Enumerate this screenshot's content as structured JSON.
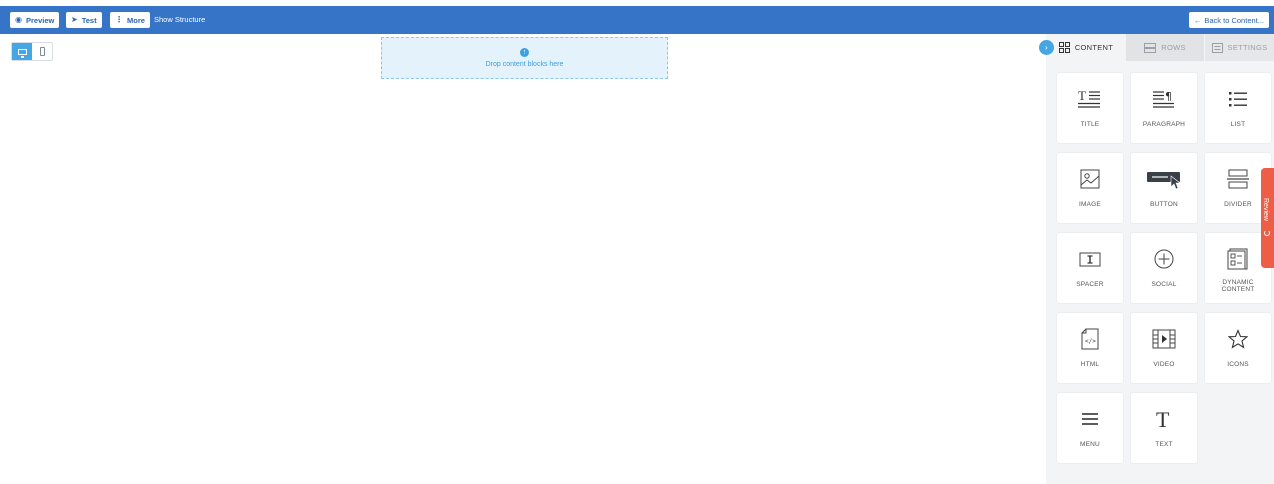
{
  "toolbar": {
    "preview_label": "Preview",
    "test_label": "Test",
    "more_label": "More",
    "show_structure_label": "Show Structure",
    "back_label": "Back to Content...",
    "colors": {
      "bar": "#3574c7",
      "button_text": "#2a64b5"
    }
  },
  "device_toggle": {
    "active": "desktop",
    "options": [
      "desktop",
      "mobile"
    ]
  },
  "canvas": {
    "drop_text": "Drop content blocks here"
  },
  "sidebar": {
    "tabs": [
      {
        "label": "CONTENT",
        "icon": "grid-icon",
        "active": true
      },
      {
        "label": "ROWS",
        "icon": "rows-icon",
        "active": false
      },
      {
        "label": "SETTINGS",
        "icon": "settings-icon",
        "active": false
      }
    ],
    "blocks": [
      {
        "label": "TITLE",
        "icon": "title-icon"
      },
      {
        "label": "PARAGRAPH",
        "icon": "paragraph-icon"
      },
      {
        "label": "LIST",
        "icon": "list-icon"
      },
      {
        "label": "IMAGE",
        "icon": "image-icon"
      },
      {
        "label": "BUTTON",
        "icon": "button-icon"
      },
      {
        "label": "DIVIDER",
        "icon": "divider-icon"
      },
      {
        "label": "SPACER",
        "icon": "spacer-icon"
      },
      {
        "label": "SOCIAL",
        "icon": "social-icon"
      },
      {
        "label": "DYNAMIC CONTENT",
        "icon": "dynamic-content-icon"
      },
      {
        "label": "HTML",
        "icon": "html-icon"
      },
      {
        "label": "VIDEO",
        "icon": "video-icon"
      },
      {
        "label": "ICONS",
        "icon": "star-icon"
      },
      {
        "label": "MENU",
        "icon": "menu-icon"
      },
      {
        "label": "TEXT",
        "icon": "text-icon"
      }
    ]
  },
  "review": {
    "label": "Review",
    "color": "#ee5d45"
  },
  "accent_color": "#44a7e3"
}
